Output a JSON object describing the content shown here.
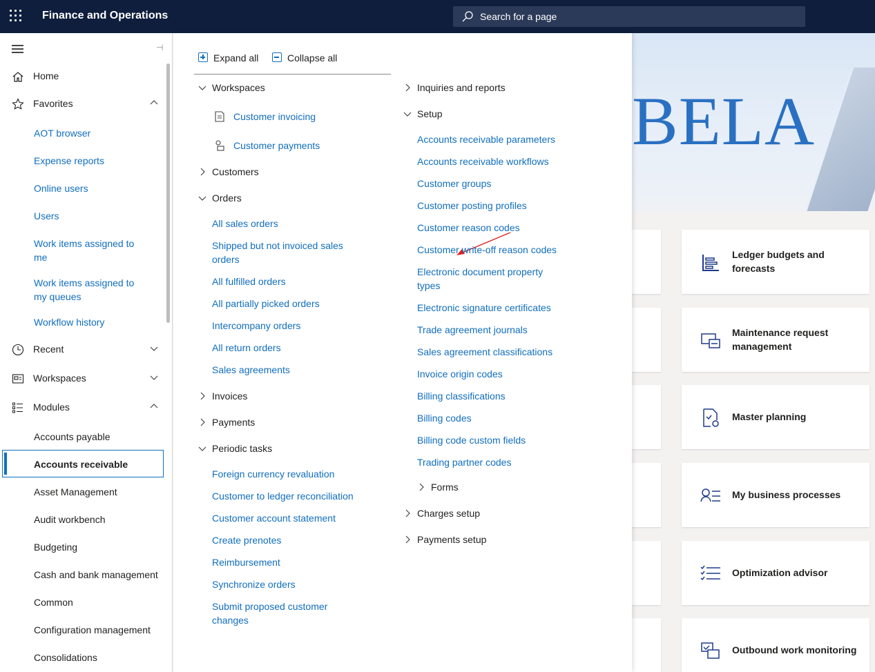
{
  "app": {
    "title": "Finance and Operations"
  },
  "search": {
    "placeholder": "Search for a page"
  },
  "nav": {
    "home": "Home",
    "favorites": "Favorites",
    "favorite_items": [
      "AOT browser",
      "Expense reports",
      "Online users",
      "Users",
      "Work items assigned to me",
      "Work items assigned to my queues",
      "Workflow history"
    ],
    "recent": "Recent",
    "workspaces": "Workspaces",
    "modules": "Modules",
    "module_items": [
      "Accounts payable",
      "Accounts receivable",
      "Asset Management",
      "Audit workbench",
      "Budgeting",
      "Cash and bank management",
      "Common",
      "Configuration management",
      "Consolidations"
    ],
    "selected_module": "Accounts receivable"
  },
  "panel": {
    "expand_all": "Expand all",
    "collapse_all": "Collapse all",
    "left": {
      "workspaces": "Workspaces",
      "workspace_items": [
        "Customer invoicing",
        "Customer payments"
      ],
      "customers": "Customers",
      "orders": "Orders",
      "order_items": [
        "All sales orders",
        "Shipped but not invoiced sales orders",
        "All fulfilled orders",
        "All partially picked orders",
        "Intercompany orders",
        "All return orders",
        "Sales agreements"
      ],
      "invoices": "Invoices",
      "payments": "Payments",
      "periodic": "Periodic tasks",
      "periodic_items": [
        "Foreign currency revaluation",
        "Customer to ledger reconciliation",
        "Customer account statement",
        "Create prenotes",
        "Reimbursement",
        "Synchronize orders",
        "Submit proposed customer changes"
      ]
    },
    "right": {
      "inquiries": "Inquiries and reports",
      "setup": "Setup",
      "setup_items": [
        "Accounts receivable parameters",
        "Accounts receivable workflows",
        "Customer groups",
        "Customer posting profiles",
        "Customer reason codes",
        "Customer write-off reason codes",
        "Electronic document property types",
        "Electronic signature certificates",
        "Trade agreement journals",
        "Sales agreement classifications",
        "Invoice origin codes",
        "Billing classifications",
        "Billing codes",
        "Billing code custom fields",
        "Trading partner codes"
      ],
      "forms": "Forms",
      "charges": "Charges setup",
      "payments_setup": "Payments setup"
    }
  },
  "hero": {
    "text": "BELA"
  },
  "tiles": [
    "Ledger budgets and forecasts",
    "Maintenance request management",
    "Master planning",
    "My business processes",
    "Optimization advisor",
    "Outbound work monitoring"
  ],
  "colors": {
    "topbar": "#0f1e3d",
    "link": "#106ebe",
    "accent": "#106ebe"
  }
}
